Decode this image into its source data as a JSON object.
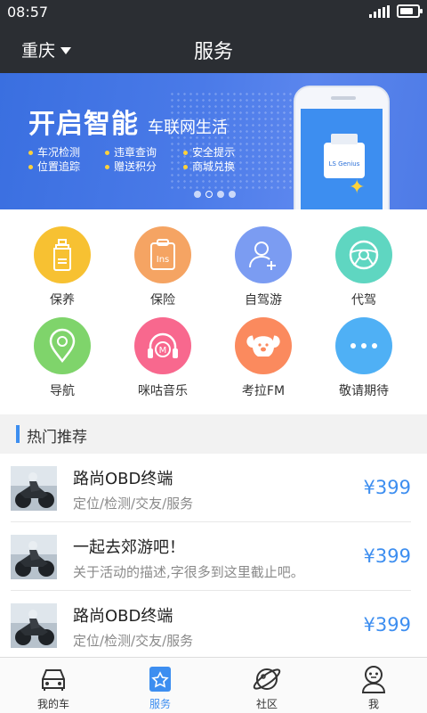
{
  "status": {
    "time": "08:57",
    "battery_level": 0.8
  },
  "header": {
    "city": "重庆",
    "title": "服务"
  },
  "banner": {
    "headline": "开启智能",
    "subhead": "车联网生活",
    "features": [
      "车况检测",
      "违章查询",
      "安全提示",
      "位置追踪",
      "赠送积分",
      "商城兑换"
    ],
    "device_label": "LS Genius",
    "active_page": 2,
    "page_count": 4
  },
  "services": [
    {
      "label": "保养",
      "icon": "bottle-icon",
      "color": "#f7c132"
    },
    {
      "label": "保险",
      "icon": "insurance-icon",
      "color": "#f5a463"
    },
    {
      "label": "自驾游",
      "icon": "add-user-icon",
      "color": "#7b9cf2"
    },
    {
      "label": "代驾",
      "icon": "steering-wheel-icon",
      "color": "#5fd6c1"
    },
    {
      "label": "导航",
      "icon": "location-pin-icon",
      "color": "#7fd46b"
    },
    {
      "label": "咪咕音乐",
      "icon": "headphones-icon",
      "color": "#f8688e"
    },
    {
      "label": "考拉FM",
      "icon": "koala-icon",
      "color": "#fb8a5e"
    },
    {
      "label": "敬请期待",
      "icon": "more-icon",
      "color": "#4fb0f5"
    }
  ],
  "section": {
    "title": "热门推荐"
  },
  "recommendations": [
    {
      "name": "路尚OBD终端",
      "desc": "定位/检测/交友/服务",
      "price": "¥399"
    },
    {
      "name": "一起去郊游吧！",
      "desc": "关于活动的描述,字很多到这里截止吧。",
      "price": "¥399"
    },
    {
      "name": "路尚OBD终端",
      "desc": "定位/检测/交友/服务",
      "price": "¥399"
    }
  ],
  "tabs": [
    {
      "label": "我的车",
      "icon": "car-icon",
      "active": false
    },
    {
      "label": "服务",
      "icon": "service-icon",
      "active": true
    },
    {
      "label": "社区",
      "icon": "planet-icon",
      "active": false
    },
    {
      "label": "我",
      "icon": "profile-icon",
      "active": false
    }
  ],
  "colors": {
    "accent": "#3d8ef0",
    "header_bg": "#2b2e33",
    "price": "#3d8ef0"
  }
}
